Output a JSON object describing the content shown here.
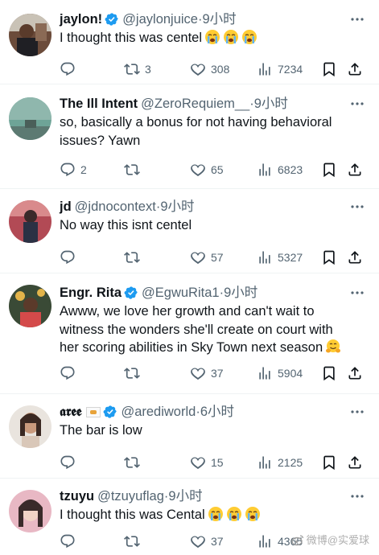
{
  "tweets": [
    {
      "name": "jaylon!",
      "verified": true,
      "handle": "@jaylonjuice",
      "dot": "·",
      "time": "9小时",
      "text": "I thought this was centel",
      "emoji": "loudly-crying-face x3",
      "reply_count": "",
      "retweet_count": "3",
      "like_count": "308",
      "view_count": "7234"
    },
    {
      "name": "The Ill Intent",
      "verified": false,
      "handle": "@ZeroRequiem__",
      "dot": "·",
      "time": "9小时",
      "text": "so, basically a bonus for not having behavioral issues? Yawn",
      "reply_count": "2",
      "retweet_count": "",
      "like_count": "65",
      "view_count": "6823"
    },
    {
      "name": "jd",
      "verified": false,
      "handle": "@jdnocontext",
      "dot": "·",
      "time": "9小时",
      "text": "No way this isnt centel",
      "reply_count": "",
      "retweet_count": "",
      "like_count": "57",
      "view_count": "5327"
    },
    {
      "name": "Engr. Rita",
      "verified": true,
      "handle": "@EgwuRita1",
      "dot": "·",
      "time": "9小时",
      "text": "Awww, we love her growth and can't wait to witness the wonders she'll create on court with her scoring abilities in Sky Town next season",
      "emoji": "hugging-face",
      "reply_count": "",
      "retweet_count": "",
      "like_count": "37",
      "view_count": "5904"
    },
    {
      "name": "𝖆𝖗𝖊𝖊",
      "verified": true,
      "handle": "@arediworld",
      "dot": "·",
      "time": "6小时",
      "text": "The bar is low",
      "reply_count": "",
      "retweet_count": "",
      "like_count": "15",
      "view_count": "2125"
    },
    {
      "name": "tzuyu",
      "verified": false,
      "handle": "@tzuyuflag",
      "dot": "·",
      "time": "9小时",
      "text": "I thought this was Cental",
      "emoji": "loudly-crying-face x3",
      "reply_count": "",
      "retweet_count": "",
      "like_count": "37",
      "view_count": "4365"
    }
  ],
  "watermark": "微博@实爱球",
  "colors": {
    "text": "#0f1419",
    "secondary": "#536471",
    "verified": "#1d9bf0",
    "divider": "#eff3f4"
  }
}
